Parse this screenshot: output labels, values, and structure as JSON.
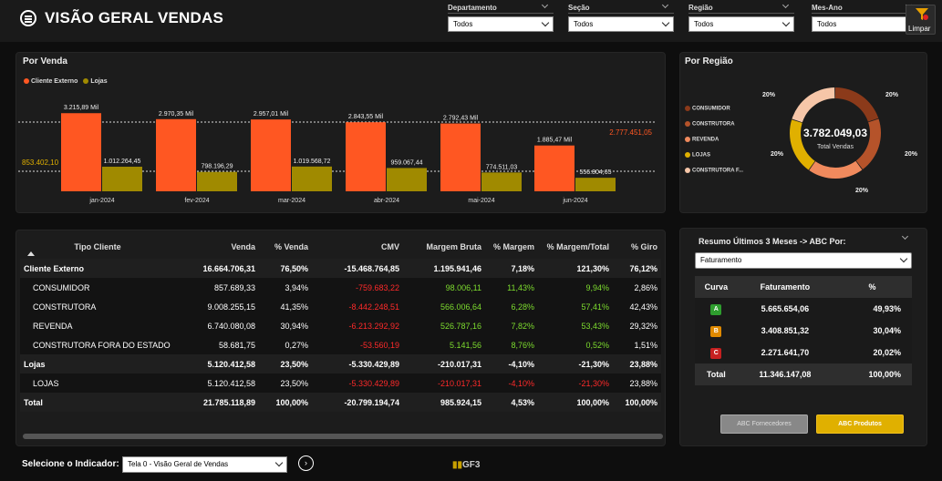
{
  "header": {
    "title": "VISÃO GERAL VENDAS",
    "clear_label": "Limpar"
  },
  "filters": [
    {
      "label": "Departamento",
      "value": "Todos"
    },
    {
      "label": "Seção",
      "value": "Todos"
    },
    {
      "label": "Região",
      "value": "Todos"
    },
    {
      "label": "Mes-Ano",
      "value": "Todos"
    }
  ],
  "sales_panel": {
    "title": "Por Venda",
    "legend": [
      "Cliente Externo",
      "Lojas"
    ],
    "ref_lines": {
      "top": "2.777.451,05",
      "bottom": "853.402,10"
    }
  },
  "chart_data": {
    "type": "bar",
    "categories": [
      "jan-2024",
      "fev-2024",
      "mar-2024",
      "abr-2024",
      "mai-2024",
      "jun-2024"
    ],
    "series": [
      {
        "name": "Cliente Externo",
        "values": [
          3215.89,
          2970.35,
          2957.01,
          2843.55,
          2792.43,
          1885.47
        ],
        "labels": [
          "3.215,89 Mil",
          "2.970,35 Mil",
          "2.957,01 Mil",
          "2.843,55 Mil",
          "2.792,43 Mil",
          "1.885,47 Mil"
        ],
        "color": "#ff5722"
      },
      {
        "name": "Lojas",
        "values": [
          1012.26445,
          798.19629,
          1019.56872,
          959.06744,
          774.51103,
          556.80465
        ],
        "labels": [
          "1.012.264,45",
          "798.196,29",
          "1.019.568,72",
          "959.067,44",
          "774.511,03",
          "556.804,65"
        ],
        "color": "#a08a00"
      }
    ],
    "ylim": [
      0,
      3300
    ]
  },
  "region_panel": {
    "title": "Por Região",
    "total": "3.782.049,03",
    "total_label": "Total Vendas",
    "legend": [
      {
        "name": "CONSUMIDOR",
        "color": "#8b3a1a"
      },
      {
        "name": "CONSTRUTORA",
        "color": "#b5532a"
      },
      {
        "name": "REVENDA",
        "color": "#f08a5d"
      },
      {
        "name": "LOJAS",
        "color": "#e0b000"
      },
      {
        "name": "CONSTRUTORA F...",
        "color": "#f6c6a8"
      }
    ],
    "slices": [
      {
        "name": "CONSUMIDOR",
        "pct": "20%"
      },
      {
        "name": "CONSTRUTORA",
        "pct": "20%"
      },
      {
        "name": "REVENDA",
        "pct": "20%"
      },
      {
        "name": "LOJAS",
        "pct": "20%"
      },
      {
        "name": "CONSTRUTORA F...",
        "pct": "20%"
      }
    ]
  },
  "table": {
    "headers": [
      "Tipo Cliente",
      "Venda",
      "% Venda",
      "CMV",
      "Margem Bruta",
      "% Margem",
      "% Margem/Total",
      "% Giro"
    ],
    "rows": [
      {
        "type": "grp",
        "cells": [
          "Cliente Externo",
          "16.664.706,31",
          "76,50%",
          "-15.468.764,85",
          "1.195.941,46",
          "7,18%",
          "121,30%",
          "76,12%"
        ]
      },
      {
        "type": "sub",
        "cells": [
          "CONSUMIDOR",
          "857.689,33",
          "3,94%",
          "-759.683,22",
          "98.006,11",
          "11,43%",
          "9,94%",
          "2,86%"
        ],
        "colors": [
          "",
          "",
          "",
          "neg",
          "pos",
          "pos",
          "pos",
          ""
        ]
      },
      {
        "type": "sub",
        "cells": [
          "CONSTRUTORA",
          "9.008.255,15",
          "41,35%",
          "-8.442.248,51",
          "566.006,64",
          "6,28%",
          "57,41%",
          "42,43%"
        ],
        "colors": [
          "",
          "",
          "",
          "neg",
          "pos",
          "pos",
          "pos",
          ""
        ]
      },
      {
        "type": "sub",
        "cells": [
          "REVENDA",
          "6.740.080,08",
          "30,94%",
          "-6.213.292,92",
          "526.787,16",
          "7,82%",
          "53,43%",
          "29,32%"
        ],
        "colors": [
          "",
          "",
          "",
          "neg",
          "pos",
          "pos",
          "pos",
          ""
        ]
      },
      {
        "type": "sub",
        "cells": [
          "CONSTRUTORA FORA DO ESTADO",
          "58.681,75",
          "0,27%",
          "-53.560,19",
          "5.141,56",
          "8,76%",
          "0,52%",
          "1,51%"
        ],
        "colors": [
          "",
          "",
          "",
          "neg",
          "pos",
          "pos",
          "pos",
          ""
        ]
      },
      {
        "type": "grp",
        "cells": [
          "Lojas",
          "5.120.412,58",
          "23,50%",
          "-5.330.429,89",
          "-210.017,31",
          "-4,10%",
          "-21,30%",
          "23,88%"
        ]
      },
      {
        "type": "sub",
        "cells": [
          "LOJAS",
          "5.120.412,58",
          "23,50%",
          "-5.330.429,89",
          "-210.017,31",
          "-4,10%",
          "-21,30%",
          "23,88%"
        ],
        "colors": [
          "",
          "",
          "",
          "neg",
          "neg",
          "neg",
          "neg",
          ""
        ]
      },
      {
        "type": "grp",
        "cells": [
          "Total",
          "21.785.118,89",
          "100,00%",
          "-20.799.194,74",
          "985.924,15",
          "4,53%",
          "100,00%",
          "100,00%"
        ]
      }
    ]
  },
  "abc_panel": {
    "title": "Resumo Últimos 3 Meses -> ABC Por:",
    "selected": "Faturamento",
    "headers": [
      "Curva",
      "Faturamento",
      "%"
    ],
    "rows": [
      {
        "curve": "A",
        "color": "#2e9e2e",
        "value": "5.665.654,06",
        "pct": "49,93%"
      },
      {
        "curve": "B",
        "color": "#e08a00",
        "value": "3.408.851,32",
        "pct": "30,04%"
      },
      {
        "curve": "C",
        "color": "#c62020",
        "value": "2.271.641,70",
        "pct": "20,02%"
      }
    ],
    "total": {
      "label": "Total",
      "value": "11.346.147,08",
      "pct": "100,00%"
    },
    "buttons": {
      "fornecedores": "ABC Fornecedores",
      "produtos": "ABC Produtos"
    }
  },
  "footer": {
    "indicator_label": "Selecione o Indicador:",
    "indicator_value": "Tela 0 - Visão Geral de Vendas",
    "logo": "GF3"
  }
}
